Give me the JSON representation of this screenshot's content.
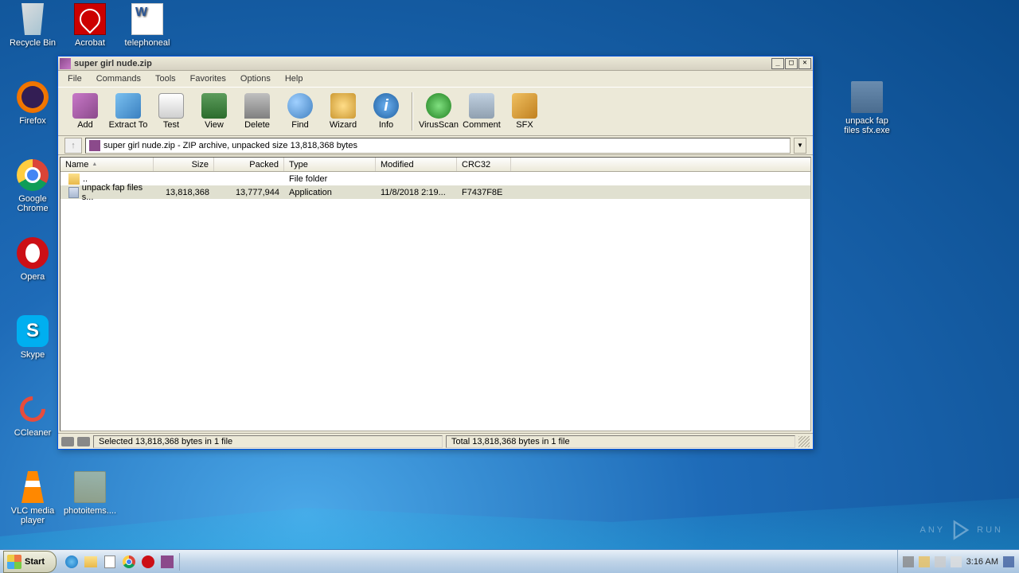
{
  "desktop": {
    "recycle": "Recycle Bin",
    "acrobat": "Acrobat",
    "word": "telephoneal",
    "firefox": "Firefox",
    "chrome": "Google Chrome",
    "opera": "Opera",
    "skype": "Skype",
    "ccleaner": "CCleaner",
    "vlc": "VLC media player",
    "photoitems": "photoitems....",
    "unpack": "unpack fap files sfx.exe"
  },
  "window": {
    "title": "super girl nude.zip",
    "menu": {
      "file": "File",
      "commands": "Commands",
      "tools": "Tools",
      "favorites": "Favorites",
      "options": "Options",
      "help": "Help"
    },
    "tools": {
      "add": "Add",
      "extract": "Extract To",
      "test": "Test",
      "view": "View",
      "delete": "Delete",
      "find": "Find",
      "wizard": "Wizard",
      "info": "Info",
      "virus": "VirusScan",
      "comment": "Comment",
      "sfx": "SFX"
    },
    "path": "super girl nude.zip - ZIP archive, unpacked size 13,818,368 bytes",
    "cols": {
      "name": "Name",
      "size": "Size",
      "packed": "Packed",
      "type": "Type",
      "modified": "Modified",
      "crc": "CRC32"
    },
    "rows": {
      "up": {
        "name": "..",
        "type": "File folder"
      },
      "file": {
        "name": "unpack fap files s...",
        "size": "13,818,368",
        "packed": "13,777,944",
        "type": "Application",
        "modified": "11/8/2018 2:19...",
        "crc": "F7437F8E"
      }
    },
    "status": {
      "selected": "Selected 13,818,368 bytes in 1 file",
      "total": "Total 13,818,368 bytes in 1 file"
    }
  },
  "taskbar": {
    "start": "Start",
    "clock": "3:16 AM"
  },
  "watermark": {
    "text1": "ANY",
    "text2": "RUN"
  }
}
